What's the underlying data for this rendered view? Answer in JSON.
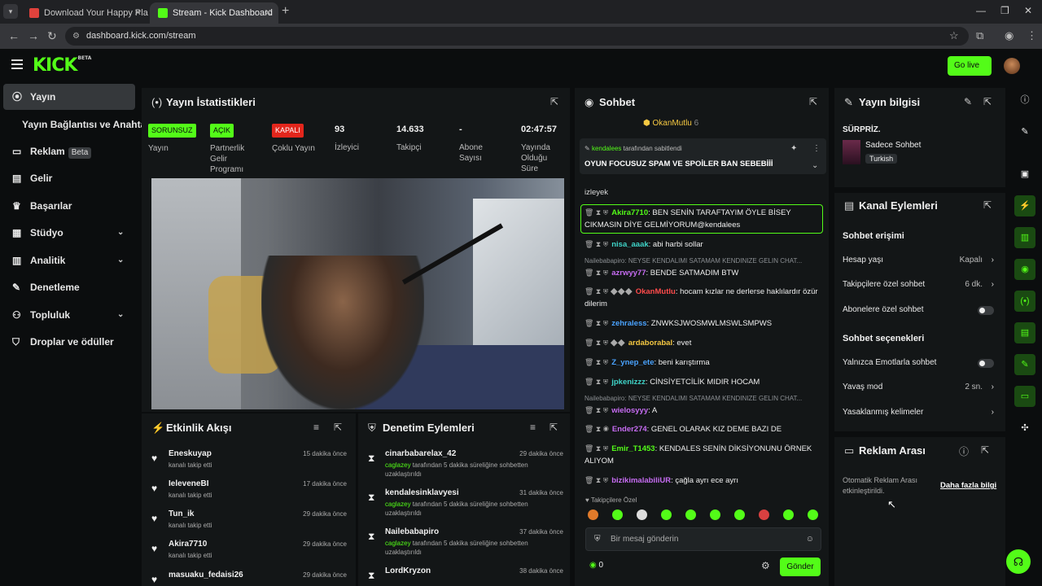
{
  "browser": {
    "tabs": [
      {
        "title": "Download Your Happy Place by"
      },
      {
        "title": "Stream - Kick Dashboard"
      }
    ],
    "url": "dashboard.kick.com/stream"
  },
  "header": {
    "logo": "KICK",
    "logo_badge": "BETA",
    "go_live": "Go live"
  },
  "sidebar": {
    "items": [
      {
        "label": "Yayın",
        "icon": "broadcast-icon"
      },
      {
        "label": "Yayın Bağlantısı ve Anahtarı"
      },
      {
        "label": "Reklam",
        "badge": "Beta",
        "icon": "ad-icon"
      },
      {
        "label": "Gelir",
        "icon": "revenue-icon"
      },
      {
        "label": "Başarılar",
        "icon": "trophy-icon"
      },
      {
        "label": "Stüdyo",
        "icon": "studio-icon"
      },
      {
        "label": "Analitik",
        "icon": "chart-icon"
      },
      {
        "label": "Denetleme",
        "icon": "wrench-icon"
      },
      {
        "label": "Topluluk",
        "icon": "community-icon"
      },
      {
        "label": "Droplar ve ödüller",
        "icon": "drops-icon"
      }
    ]
  },
  "stats": {
    "title": "Yayın İstatistikleri",
    "items": [
      {
        "badge": "SORUNSUZ",
        "label": "Yayın"
      },
      {
        "badge": "AÇIK",
        "label": "Partnerlik Gelir Programı"
      },
      {
        "badge": "KAPALI",
        "label": "Çoklu Yayın"
      },
      {
        "value": "93",
        "label": "İzleyici"
      },
      {
        "value": "14.633",
        "label": "Takipçi"
      },
      {
        "value": "-",
        "label": "Abone Sayısı"
      },
      {
        "value": "02:47:57",
        "label": "Yayında Olduğu Süre"
      }
    ]
  },
  "activity": {
    "title": "Etkinlik Akışı",
    "items": [
      {
        "name": "Eneskuyap",
        "sub": "kanalı takip etti",
        "time": "15 dakika önce"
      },
      {
        "name": "IeleveneBI",
        "sub": "kanalı takip etti",
        "time": "17 dakika önce"
      },
      {
        "name": "Tun_ik",
        "sub": "kanalı takip etti",
        "time": "29 dakika önce"
      },
      {
        "name": "Akira7710",
        "sub": "kanalı takip etti",
        "time": "29 dakika önce"
      },
      {
        "name": "masuaku_fedaisi26",
        "sub": "",
        "time": "29 dakika önce"
      }
    ]
  },
  "moderation": {
    "title": "Denetim Eylemleri",
    "items": [
      {
        "name": "cinarbabarelax_42",
        "mod": "caglazey",
        "sub": " tarafından 5 dakika süreliğine sohbetten uzaklaştırıldı",
        "time": "29 dakika önce"
      },
      {
        "name": "kendalesinklavyesi",
        "mod": "caglazey",
        "sub": " tarafından 5 dakika süreliğine sohbetten uzaklaştırıldı",
        "time": "31 dakika önce"
      },
      {
        "name": "Nailebabapiro",
        "mod": "caglazey",
        "sub": " tarafından 5 dakika süreliğine sohbetten uzaklaştırıldı",
        "time": "37 dakika önce"
      },
      {
        "name": "LordKryzon",
        "mod": "",
        "sub": "",
        "time": "38 dakika önce"
      }
    ]
  },
  "chat": {
    "title": "Sohbet",
    "top_user": "OkanMutlu",
    "top_count": "6",
    "pinned": {
      "by": "kendalees",
      "by_suffix": "tarafından sabitlendi",
      "text": "OYUN FOCUSUZ SPAM VE SPOİLER BAN SEBEBİİİ"
    },
    "partial": "izleyek",
    "messages": [
      {
        "user": "Akira7710",
        "color": "#53fc18",
        "text": ": BEN SENİN TARAFTAYIM ÖYLE BİSEY CIKMASIN DİYE GELMİYORUM@kendalees",
        "highlight": true
      },
      {
        "user": "nisa_aaak",
        "color": "#3fd4c8",
        "text": ": abi harbi sollar"
      },
      {
        "user": "azrwyy77",
        "color": "#c66cf2",
        "text": ": BENDE SATMADIM BTW"
      },
      {
        "user": "OkanMutlu",
        "color": "#ff4b4b",
        "text": ": hocam kızlar ne derlerse haklılardır özür dilerim"
      },
      {
        "user": "zehraless",
        "color": "#4aa3ff",
        "text": ": ZNWKSJWOSMWLMSWLSMPWS"
      },
      {
        "user": "ardaborabal",
        "color": "#f5c842",
        "text": ": evet"
      },
      {
        "user": "Z_ynep_ete",
        "color": "#4aa3ff",
        "text": ": beni karıştırma"
      },
      {
        "user": "jpkenizzz",
        "color": "#3fd4c8",
        "text": ": CİNSİYETCİLİK MIDIR HOCAM"
      },
      {
        "user": "wielosyyy",
        "color": "#c66cf2",
        "text": ": A"
      },
      {
        "user": "Ender274",
        "color": "#c66cf2",
        "text": ": GENEL OLARAK KIZ DEME BAZI DE"
      },
      {
        "user": "Emir_T1453",
        "color": "#53fc18",
        "text": ": KENDALES SENİN DİKSİYONUNU ÖRNEK ALIYOM"
      },
      {
        "user": "bizikimalabiliUR",
        "color": "#c66cf2",
        "text": ": çağla ayrı ece ayrı"
      }
    ],
    "system": [
      "Nailebabapiro: NEYSE KENDALIMI SATAMAM KENDINIZE GELIN CHAT...",
      "Nailebabapiro: NEYSE KENDALIMI SATAMAM KENDINIZE GELIN CHAT..."
    ],
    "followers_only": "Takipçilere Özel",
    "input_placeholder": "Bir mesaj gönderin",
    "viewer_count": "0",
    "send": "Gönder"
  },
  "stream_info": {
    "title": "Yayın bilgisi",
    "stream_title": "SÜRPRİZ.",
    "category": "Sadece Sohbet",
    "tag": "Turkish"
  },
  "channel_actions": {
    "title": "Kanal Eylemleri",
    "access_title": "Sohbet erişimi",
    "rows": [
      {
        "label": "Hesap yaşı",
        "value": "Kapalı"
      },
      {
        "label": "Takipçilere özel sohbet",
        "value": "6 dk.",
        "green": true
      },
      {
        "label": "Abonelere özel sohbet",
        "toggle": true
      }
    ],
    "options_title": "Sohbet seçenekleri",
    "options": [
      {
        "label": "Yalnızca Emotlarla sohbet",
        "toggle": true
      },
      {
        "label": "Yavaş mod",
        "value": "2 sn.",
        "green": true
      },
      {
        "label": "Yasaklanmış kelimeler"
      }
    ]
  },
  "ad_break": {
    "title": "Reklam Arası",
    "text": "Otomatik Reklam Arası etkinleştirildi.",
    "link": "Daha fazla bilgi"
  },
  "colors": {
    "accent": "#53fc18",
    "panel": "#131617"
  }
}
